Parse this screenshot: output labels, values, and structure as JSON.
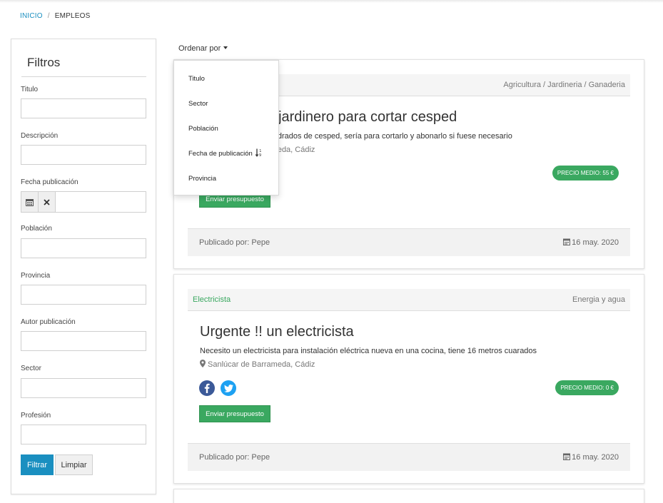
{
  "breadcrumb": {
    "home": "INICIO",
    "separator": "/",
    "current": "EMPLEOS"
  },
  "filters": {
    "title": "Filtros",
    "fields": [
      {
        "label": "Titulo",
        "value": ""
      },
      {
        "label": "Descripción",
        "value": ""
      },
      {
        "label": "Fecha publicación",
        "value": ""
      },
      {
        "label": "Población",
        "value": ""
      },
      {
        "label": "Provincia",
        "value": ""
      },
      {
        "label": "Autor publicación",
        "value": ""
      },
      {
        "label": "Sector",
        "value": ""
      },
      {
        "label": "Profesión",
        "value": ""
      }
    ],
    "date_icon": "calendar-icon",
    "clear_date_icon": "x-icon",
    "filter_label": "Filtrar",
    "clear_label": "Limpiar"
  },
  "sort": {
    "label": "Ordenar por",
    "options": [
      "Titulo",
      "Sector",
      "Población",
      "Fecha de publicación",
      "Provincia"
    ],
    "active_icon": "sort-numeric-down-icon"
  },
  "jobs": [
    {
      "profession": "",
      "sector": "Agricultura / Jardineria / Ganaderia",
      "title": "Se necesita jardinero para cortar cesped",
      "description": "Tengo 500 metros cuadrados de cesped, sería para cortarlo y abonarlo si fuese necesario",
      "location": "Sanlúcar de Barrameda, Cádiz",
      "price": "PRECIO MEDIO: 55 €",
      "quote_label": "Enviar presupuesto",
      "author": "Publicado por: Pepe",
      "date": "16 may. 2020"
    },
    {
      "profession": "Electricista",
      "sector": "Energia y agua",
      "title": "Urgente !! un electricista",
      "description": "Necesito un electricista para instalación eléctrica nueva en una cocina, tiene 16 metros cuarados",
      "location": "Sanlúcar de Barrameda, Cádiz",
      "price": "PRECIO MEDIO: 0 €",
      "quote_label": "Enviar presupuesto",
      "author": "Publicado por: Pepe",
      "date": "16 may. 2020"
    }
  ],
  "colors": {
    "accent_blue": "#1a8fc0",
    "accent_green": "#3aa860"
  }
}
